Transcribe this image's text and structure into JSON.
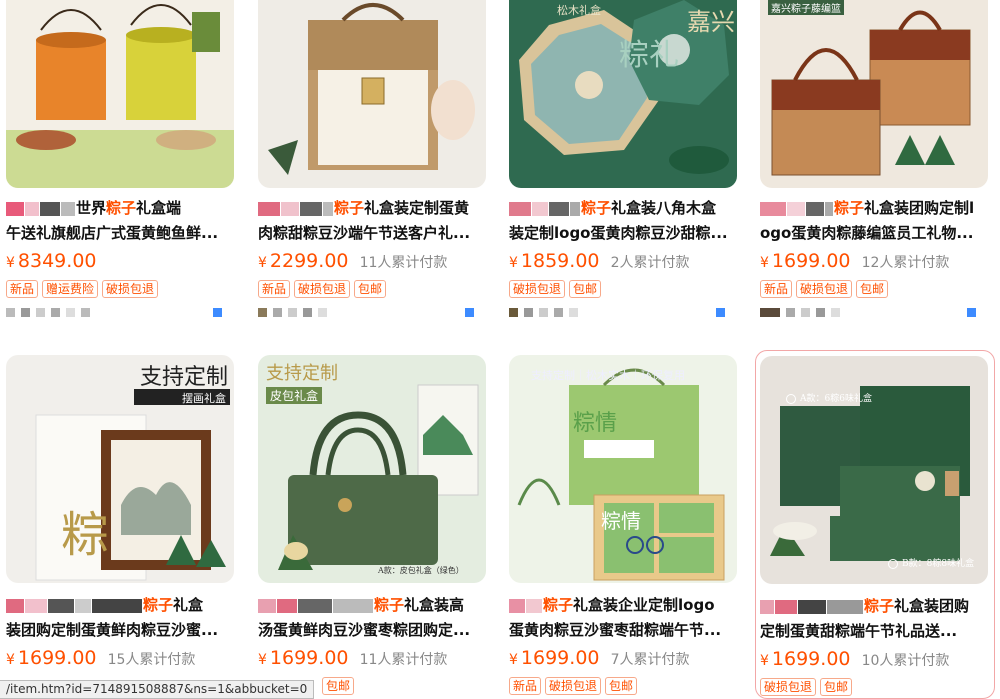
{
  "products": [
    {
      "title_pre": "世界",
      "keyword": "粽子",
      "title_post": "礼盒端",
      "title_line2": "午送礼旗舰店广式蛋黄鲍鱼鲜...",
      "price": "8349.00",
      "sales": "",
      "tags": [
        "新品",
        "赠运费险",
        "破损包退"
      ]
    },
    {
      "title_pre": "",
      "keyword": "粽子",
      "title_post": "礼盒装定制蛋黄",
      "title_line2": "肉粽甜粽豆沙端午节送客户礼...",
      "price": "2299.00",
      "sales": "11人累计付款",
      "tags": [
        "新品",
        "破损包退",
        "包邮"
      ]
    },
    {
      "title_pre": "",
      "keyword": "粽子",
      "title_post": "礼盒装八角木盒",
      "title_line2": "装定制logo蛋黄肉粽豆沙甜粽...",
      "price": "1859.00",
      "sales": "2人累计付款",
      "tags": [
        "破损包退",
        "包邮"
      ],
      "image_text": [
        "松木礼盒",
        "嘉兴",
        "粽礼"
      ]
    },
    {
      "title_pre": "",
      "keyword": "粽子",
      "title_post": "礼盒装团购定制l",
      "title_line2": "ogo蛋黄肉粽藤编篮员工礼物...",
      "price": "1699.00",
      "sales": "12人累计付款",
      "tags": [
        "新品",
        "破损包退",
        "包邮"
      ],
      "image_text": [
        "嘉兴粽子藤编篮"
      ]
    },
    {
      "title_pre": "",
      "keyword": "粽子",
      "title_post": "礼盒",
      "title_line2": "装团购定制蛋黄鲜肉粽豆沙蜜...",
      "price": "1699.00",
      "sales": "15人累计付款",
      "tags": [],
      "image_text": [
        "支持定制",
        "摆画礼盒",
        "粽"
      ]
    },
    {
      "title_pre": "",
      "keyword": "粽子",
      "title_post": "礼盒装高",
      "title_line2": "汤蛋黄鲜肉豆沙蜜枣粽团购定...",
      "price": "1699.00",
      "sales": "11人累计付款",
      "tags": [
        "包邮"
      ],
      "image_text": [
        "支持定制",
        "皮包礼盒",
        "A款：皮包礼盒（绿色）"
      ]
    },
    {
      "title_pre": "",
      "keyword": "粽子",
      "title_post": "礼盒装企业定制logo",
      "title_line2": "蛋黄肉粽豆沙蜜枣甜粽端午节...",
      "price": "1699.00",
      "sales": "7人累计付款",
      "tags": [
        "新品",
        "破损包退",
        "包邮"
      ],
      "image_text": [
        "支持定制｜松木实木｜环保复用",
        "粽情",
        "粽情"
      ]
    },
    {
      "title_pre": "",
      "keyword": "粽子",
      "title_post": "礼盒装团购",
      "title_line2": "定制蛋黄甜粽端午节礼品送...",
      "price": "1699.00",
      "sales": "10人累计付款",
      "tags": [
        "破损包退",
        "包邮"
      ],
      "image_text": [
        "A款：6粽6味礼盒",
        "B款：8粽8味礼盒"
      ]
    }
  ],
  "currency": "¥",
  "status_url": "/item.htm?id=714891508887&ns=1&abbucket=0",
  "colors": {
    "accent": "#ff5000",
    "tag_border": "#f7a98a",
    "sales": "#888888"
  }
}
